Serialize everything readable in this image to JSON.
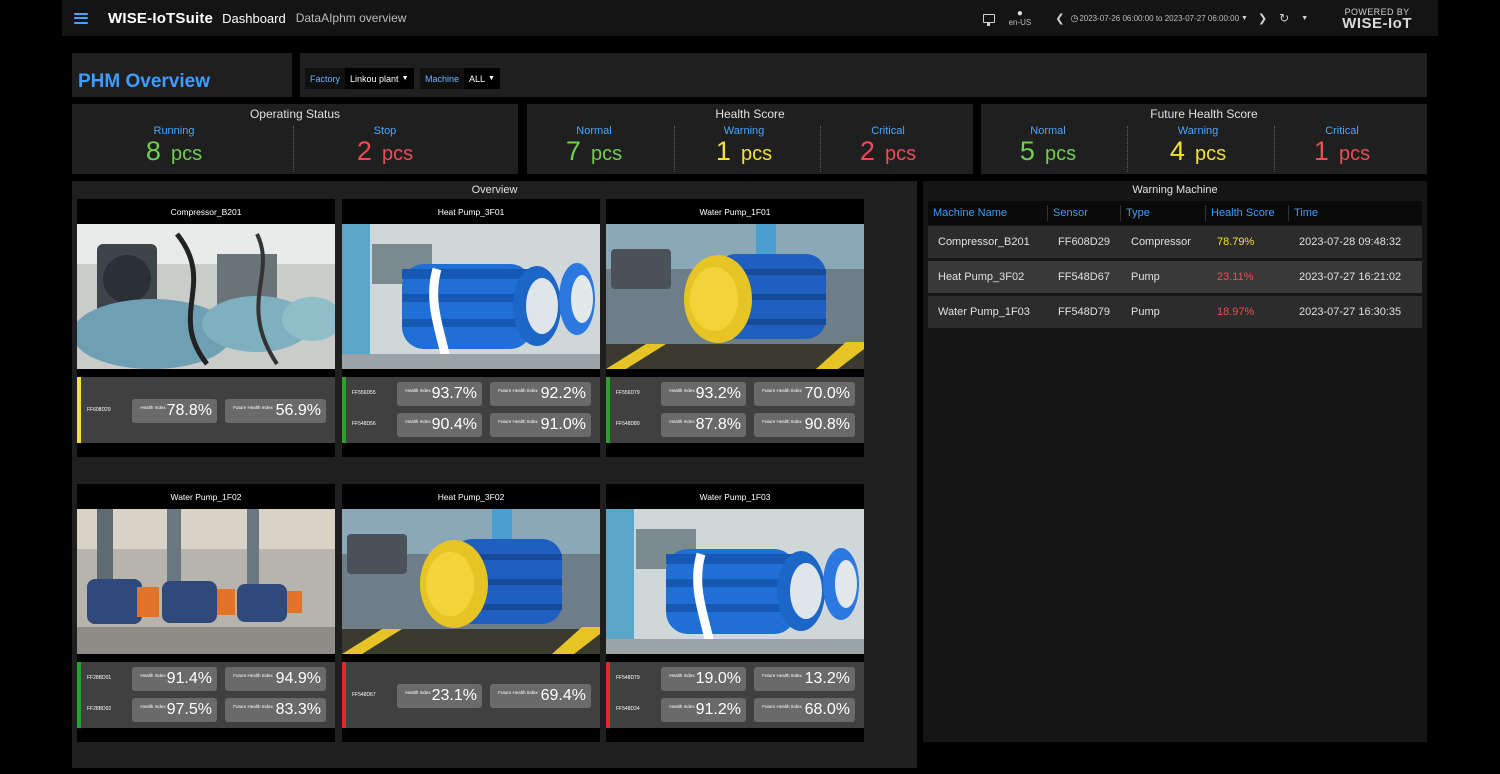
{
  "topbar": {
    "brand": "WISE-IoTSuite",
    "nav_title": "Dashboard",
    "breadcrumb": "DataAIphm overview",
    "language": "en-US",
    "time_range": "2023-07-26 06:00:00 to 2023-07-27 06:00:00",
    "powered_line1": "POWERED BY",
    "powered_line2": "WISE-IoT",
    "icons": [
      "menu-icon",
      "monitor-icon",
      "globe-icon",
      "chevron-left-icon",
      "clock-icon",
      "chevron-right-icon",
      "refresh-icon",
      "caret-down-icon"
    ]
  },
  "page": {
    "title": "PHM Overview"
  },
  "filters": {
    "factory": {
      "label": "Factory",
      "value": "Linkou plant"
    },
    "machine": {
      "label": "Machine",
      "value": "ALL"
    }
  },
  "unit": "pcs",
  "operating_status": {
    "title": "Operating Status",
    "running": {
      "label": "Running",
      "value": "8"
    },
    "stop": {
      "label": "Stop",
      "value": "2"
    }
  },
  "health_score": {
    "title": "Health Score",
    "normal": {
      "label": "Normal",
      "value": "7"
    },
    "warning": {
      "label": "Warning",
      "value": "1"
    },
    "critical": {
      "label": "Critical",
      "value": "2"
    }
  },
  "future_health_score": {
    "title": "Future Health Score",
    "normal": {
      "label": "Normal",
      "value": "5"
    },
    "warning": {
      "label": "Warning",
      "value": "4"
    },
    "critical": {
      "label": "Critical",
      "value": "1"
    }
  },
  "overview": {
    "title": "Overview",
    "health_label": "Health Index",
    "future_label": "Future Health Index",
    "cards": [
      {
        "name": "Compressor_B201",
        "image": "compressor",
        "status_colors": [
          "#f2e233"
        ],
        "sensors": [
          {
            "id": "FF608D29",
            "health": "78.8%",
            "future": "56.9%"
          }
        ]
      },
      {
        "name": "Heat Pump_3F01",
        "image": "blue-motor",
        "status_colors": [
          "#2aa12a",
          "#2aa12a"
        ],
        "sensors": [
          {
            "id": "FF556D55",
            "health": "93.7%",
            "future": "92.2%"
          },
          {
            "id": "FF548D56",
            "health": "90.4%",
            "future": "91.0%"
          }
        ]
      },
      {
        "name": "Water Pump_1F01",
        "image": "yellow-motor",
        "status_colors": [
          "#2aa12a",
          "#2aa12a"
        ],
        "sensors": [
          {
            "id": "FF556D79",
            "health": "93.2%",
            "future": "70.0%"
          },
          {
            "id": "FF548D80",
            "health": "87.8%",
            "future": "90.8%"
          }
        ]
      },
      {
        "name": "Water Pump_1F02",
        "image": "pump-row",
        "status_colors": [
          "#2aa12a",
          "#2aa12a"
        ],
        "sensors": [
          {
            "id": "FF28BD01",
            "health": "91.4%",
            "future": "94.9%"
          },
          {
            "id": "FF28BD02",
            "health": "97.5%",
            "future": "83.3%"
          }
        ]
      },
      {
        "name": "Heat Pump_3F02",
        "image": "yellow-motor",
        "status_colors": [
          "#e02a2a"
        ],
        "sensors": [
          {
            "id": "FF548D67",
            "health": "23.1%",
            "future": "69.4%"
          }
        ]
      },
      {
        "name": "Water Pump_1F03",
        "image": "blue-motor",
        "status_colors": [
          "#e02a2a",
          "#e02a2a"
        ],
        "sensors": [
          {
            "id": "FF548D79",
            "health": "19.0%",
            "future": "13.2%"
          },
          {
            "id": "FF548D34",
            "health": "91.2%",
            "future": "68.0%"
          }
        ]
      }
    ]
  },
  "warning_machine": {
    "title": "Warning Machine",
    "columns": [
      "Machine Name",
      "Sensor",
      "Type",
      "Health Score",
      "Time"
    ],
    "rows": [
      {
        "machine": "Compressor_B201",
        "sensor": "FF608D29",
        "type": "Compressor",
        "score": "78.79%",
        "level": "warning",
        "time": "2023-07-28 09:48:32"
      },
      {
        "machine": "Heat Pump_3F02",
        "sensor": "FF548D67",
        "type": "Pump",
        "score": "23.11%",
        "level": "critical",
        "time": "2023-07-27 16:21:02"
      },
      {
        "machine": "Water Pump_1F03",
        "sensor": "FF548D79",
        "type": "Pump",
        "score": "18.97%",
        "level": "critical",
        "time": "2023-07-27 16:30:35"
      }
    ]
  },
  "colors": {
    "accent": "#3f9cff",
    "normal": "#6fcf4f",
    "warning": "#f2e233",
    "critical": "#ef4b55",
    "panel": "#1f1f1f"
  }
}
